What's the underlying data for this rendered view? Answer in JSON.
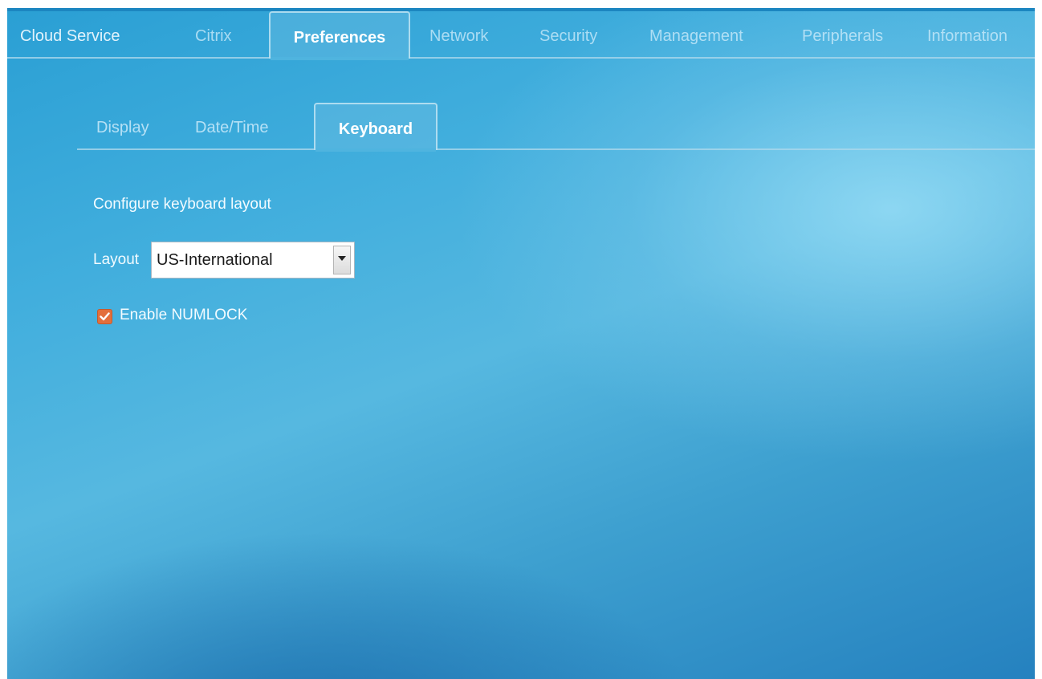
{
  "main_tabs": [
    {
      "label": "Cloud Service",
      "active": false
    },
    {
      "label": "Citrix",
      "active": false
    },
    {
      "label": "Preferences",
      "active": true
    },
    {
      "label": "Network",
      "active": false
    },
    {
      "label": "Security",
      "active": false
    },
    {
      "label": "Management",
      "active": false
    },
    {
      "label": "Peripherals",
      "active": false
    },
    {
      "label": "Information",
      "active": false
    }
  ],
  "sub_tabs": [
    {
      "label": "Display",
      "active": false
    },
    {
      "label": "Date/Time",
      "active": false
    },
    {
      "label": "Keyboard",
      "active": true
    }
  ],
  "keyboard": {
    "section_title": "Configure keyboard layout",
    "layout_label": "Layout",
    "layout_value": "US-International",
    "numlock_label": "Enable NUMLOCK",
    "numlock_checked": true
  },
  "colors": {
    "accent_checkbox": "#e36f3c",
    "background_blue": "#2a9fd4",
    "text_light": "#f2fbff"
  },
  "icons": {
    "dropdown": "chevron-down-icon",
    "checkbox": "checkmark-icon"
  }
}
